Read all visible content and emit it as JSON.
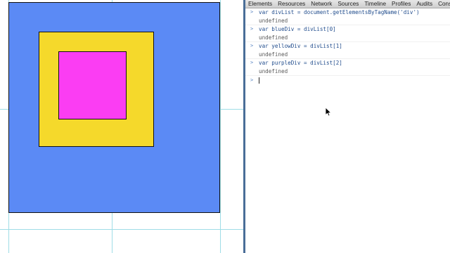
{
  "page": {
    "boxes": {
      "blue": {
        "color": "#5b8af5"
      },
      "yellow": {
        "color": "#f5d92b"
      },
      "purple": {
        "color": "#fb3df3"
      }
    },
    "guide_color": "#9fdde6"
  },
  "devtools": {
    "tabs": [
      "Elements",
      "Resources",
      "Network",
      "Sources",
      "Timeline",
      "Profiles",
      "Audits",
      "Cons"
    ],
    "console": {
      "entries": [
        {
          "command": "var divList = document.getElementsByTagName('div')",
          "result": "undefined"
        },
        {
          "command": "var blueDiv = divList[0]",
          "result": "undefined"
        },
        {
          "command": "var yellowDiv = divList[1]",
          "result": "undefined"
        },
        {
          "command": "var purpleDiv = divList[2]",
          "result": "undefined"
        }
      ],
      "prompt_symbol": ">",
      "input_value": ""
    }
  }
}
